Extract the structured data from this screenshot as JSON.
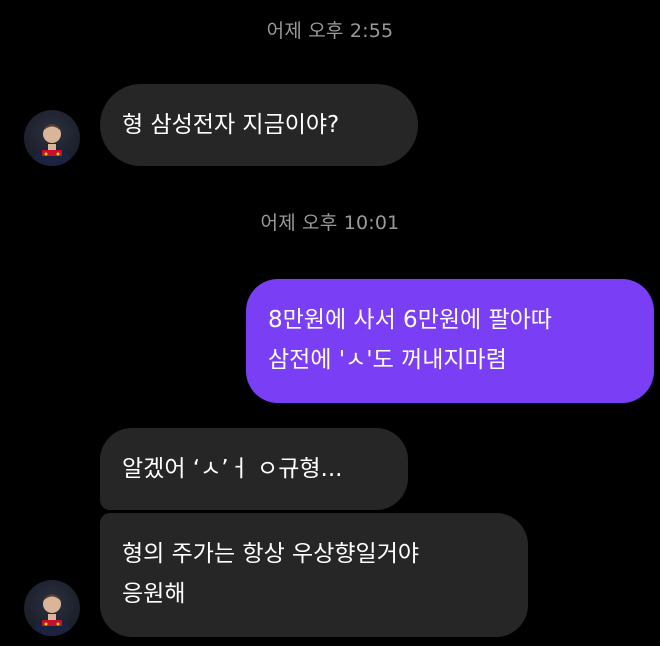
{
  "conversation": {
    "timestamps": [
      "어제 오후 2:55",
      "어제 오후 10:01"
    ],
    "messages": [
      {
        "sender": "other",
        "lines": [
          "형 삼성전자 지금이야?"
        ]
      },
      {
        "sender": "me",
        "lines": [
          "8만원에 사서 6만원에 팔아따",
          "삼전에 'ㅅ'도 꺼내지마렴"
        ]
      },
      {
        "sender": "other",
        "lines": [
          "알겠어 ‘ㅅ’ㅓ ㅇ규형..."
        ]
      },
      {
        "sender": "other",
        "lines": [
          "형의 주가는 항상 우상향일거야",
          "응원해"
        ]
      }
    ]
  },
  "colors": {
    "background": "#000000",
    "incoming_bubble": "#262626",
    "outgoing_bubble": "#7a3ef5",
    "timestamp_text": "#9a9a9a"
  },
  "icons": {
    "avatar": "profile-avatar-icon"
  }
}
